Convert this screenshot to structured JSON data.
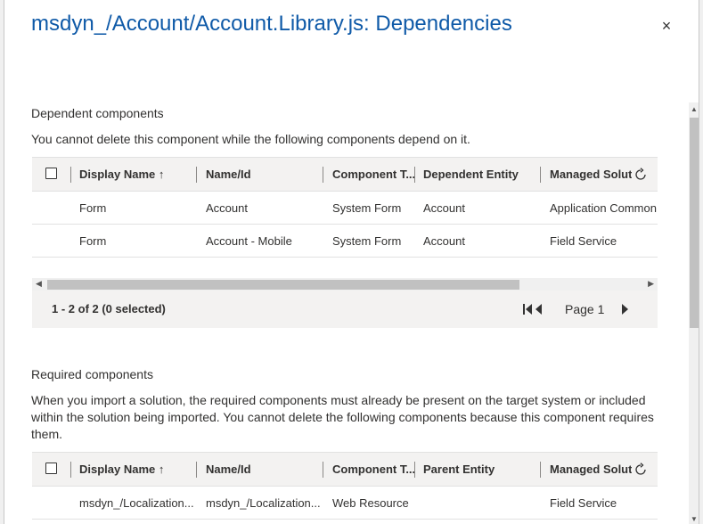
{
  "dialog": {
    "title": "msdyn_/Account/Account.Library.js: Dependencies",
    "close_icon": "×"
  },
  "dependent": {
    "title": "Dependent components",
    "description": "You cannot delete this component while the following components depend on it.",
    "columns": [
      "Display Name ↑",
      "Name/Id",
      "Component T...",
      "Dependent Entity",
      "Managed Solut"
    ],
    "rows": [
      [
        "Form",
        "Account",
        "System Form",
        "Account",
        "Application Common"
      ],
      [
        "Form",
        "Account - Mobile",
        "System Form",
        "Account",
        "Field Service"
      ]
    ],
    "count": "1 - 2 of 2 (0 selected)",
    "page": "Page 1"
  },
  "required": {
    "title": "Required components",
    "description": "When you import a solution, the required components must already be present on the target system or included within the solution being imported. You cannot delete the following components because this component requires them.",
    "columns": [
      "Display Name ↑",
      "Name/Id",
      "Component T...",
      "Parent Entity",
      "Managed Solut"
    ],
    "rows": [
      [
        "msdyn_/Localization...",
        "msdyn_/Localization...",
        "Web Resource",
        "",
        "Field Service"
      ]
    ]
  },
  "icons": {
    "refresh": "refresh-icon",
    "first_page": "first-page-icon",
    "prev_page": "previous-page-icon",
    "next_page": "next-page-icon"
  },
  "colors": {
    "title": "#0f5aa8",
    "header_bg": "#f3f2f1"
  }
}
